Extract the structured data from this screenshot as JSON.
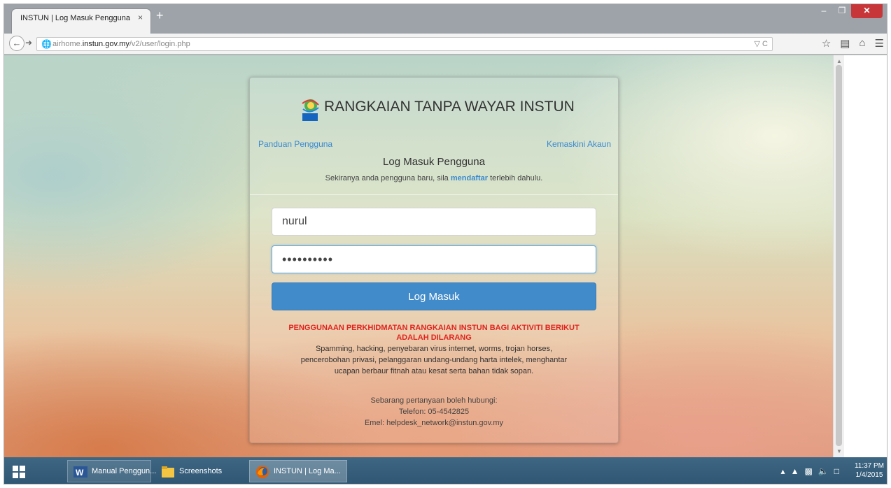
{
  "browser": {
    "tab_title": "INSTUN | Log Masuk Pengguna",
    "tab_close": "×",
    "new_tab": "+",
    "url_domain_prefix": "airhome.",
    "url_domain": "instun.gov.my",
    "url_path": "/v2/user/login.php"
  },
  "page": {
    "site_title": "RANGKAIAN TANPA WAYAR INSTUN",
    "guide_link": "Panduan Pengguna",
    "update_link": "Kemaskini Akaun",
    "form_title": "Log Masuk Pengguna",
    "register_note_before": "Sekiranya anda pengguna baru, sila ",
    "register_link": "mendaftar",
    "register_note_after": " terlebih dahulu.",
    "username_value": "nurul",
    "password_value": "••••••••••",
    "login_button": "Log Masuk",
    "warning_title_line1": "PENGGUNAAN PERKHIDMATAN RANGKAIAN INSTUN BAGI AKTIVITI BERIKUT",
    "warning_title_line2": "ADALAH DILARANG",
    "warning_body_line1": "Spamming, hacking, penyebaran virus internet, worms, trojan horses,",
    "warning_body_line2": "pencerobohan privasi, pelanggaran undang-undang harta intelek, menghantar",
    "warning_body_line3": "ucapan berbaur fitnah atau kesat serta bahan tidak sopan.",
    "contact_line1": "Sebarang pertanyaan boleh hubungi:",
    "contact_line2": "Telefon: 05-4542825",
    "contact_line3": "Emel: helpdesk_network@instun.gov.my"
  },
  "taskbar": {
    "items": [
      {
        "label": "Manual Penggun...",
        "icon": "word-icon"
      },
      {
        "label": "Screenshots",
        "icon": "folder-icon"
      },
      {
        "label": "INSTUN | Log Ma...",
        "icon": "firefox-icon"
      }
    ],
    "clock_time": "11:37 PM",
    "clock_date": "1/4/2015"
  },
  "colors": {
    "accent": "#428bca",
    "link": "#3a8ad0",
    "warning": "#e0241f"
  }
}
